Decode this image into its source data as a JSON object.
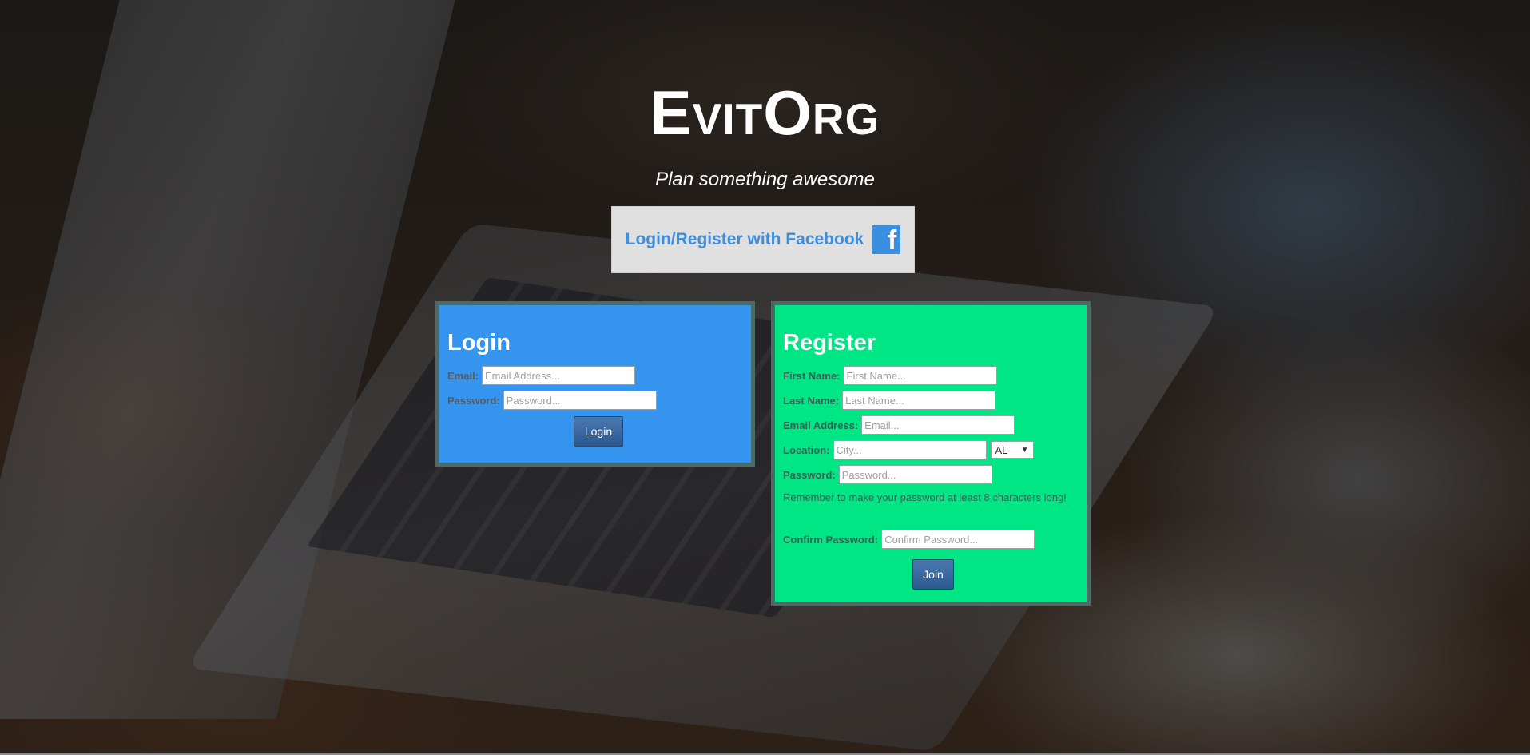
{
  "brand": {
    "name": "EvitOrg",
    "tagline": "Plan something awesome"
  },
  "facebook": {
    "label": "Login/Register with Facebook",
    "icon": "facebook-icon",
    "color": "#3b8fe0"
  },
  "login": {
    "title": "Login",
    "email_label": "Email:",
    "email_placeholder": "Email Address...",
    "password_label": "Password:",
    "password_placeholder": "Password...",
    "button": "Login",
    "bg_color": "#3594ee"
  },
  "register": {
    "title": "Register",
    "first_name_label": "First Name:",
    "first_name_placeholder": "First Name...",
    "last_name_label": "Last Name:",
    "last_name_placeholder": "Last Name...",
    "email_label": "Email Address:",
    "email_placeholder": "Email...",
    "location_label": "Location:",
    "city_placeholder": "City...",
    "state_selected": "AL",
    "password_label": "Password:",
    "password_placeholder": "Password...",
    "password_note": "Remember to make your password at least 8 characters long!",
    "confirm_label": "Confirm Password:",
    "confirm_placeholder": "Confirm Password...",
    "button": "Join",
    "bg_color": "#00e685"
  }
}
